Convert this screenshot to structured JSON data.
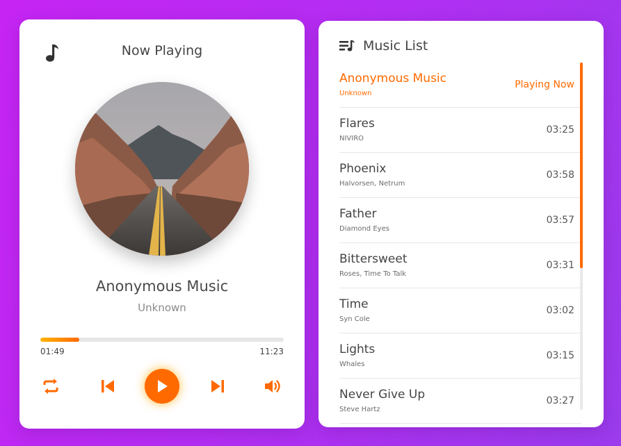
{
  "colors": {
    "accent": "#ff6a00",
    "accent_glow": "#ffaa00",
    "background": "#b02ff2"
  },
  "player": {
    "header_icon": "music-note-icon",
    "title": "Now Playing",
    "song_name": "Anonymous Music",
    "artist": "Unknown",
    "current_time": "01:49",
    "total_time": "11:23",
    "progress_percent": 16,
    "controls": [
      "repeat-icon",
      "previous-icon",
      "play-icon",
      "next-icon",
      "volume-icon"
    ]
  },
  "list": {
    "header_icon": "playlist-icon",
    "title": "Music List",
    "songs": [
      {
        "name": "Anonymous Music",
        "artist": "Unknown",
        "duration": "Playing Now",
        "active": true
      },
      {
        "name": "Flares",
        "artist": "NIVIRO",
        "duration": "03:25"
      },
      {
        "name": "Phoenix",
        "artist": "Halvorsen, Netrum",
        "duration": "03:58"
      },
      {
        "name": "Father",
        "artist": "Diamond Eyes",
        "duration": "03:57"
      },
      {
        "name": "Bittersweet",
        "artist": "Roses, Time To Talk",
        "duration": "03:31"
      },
      {
        "name": "Time",
        "artist": "Syn Cole",
        "duration": "03:02"
      },
      {
        "name": "Lights",
        "artist": "Whales",
        "duration": "03:15"
      },
      {
        "name": "Never Give Up",
        "artist": "Steve Hartz",
        "duration": "03:27"
      }
    ]
  }
}
